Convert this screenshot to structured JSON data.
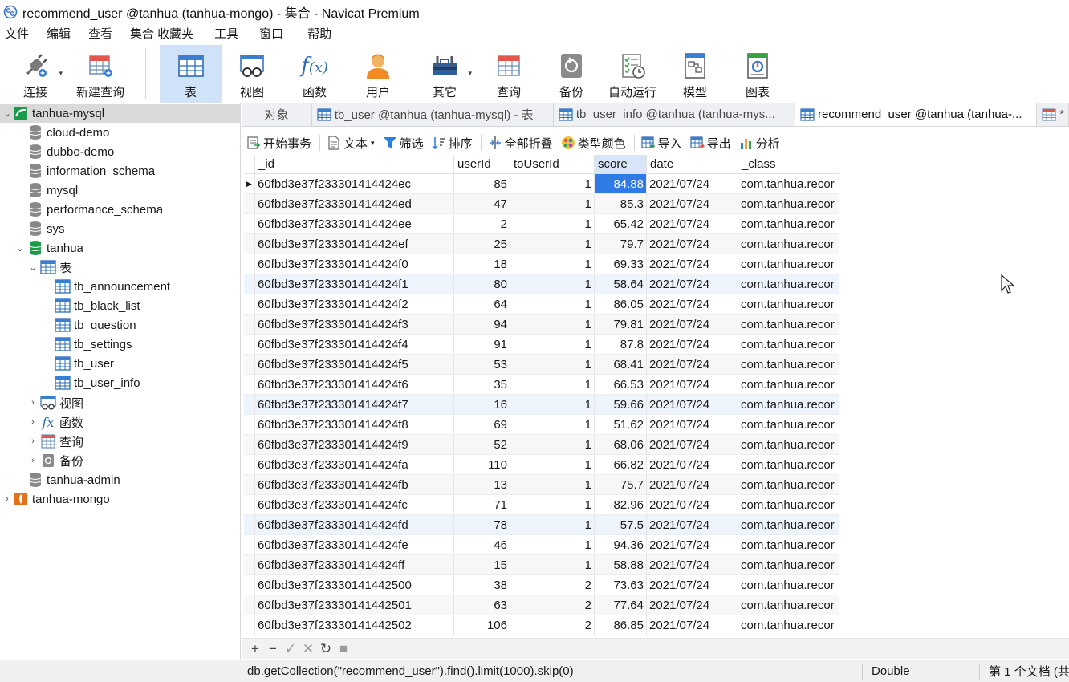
{
  "window": {
    "title": "recommend_user @tanhua (tanhua-mongo) - 集合 - Navicat Premium"
  },
  "menu": [
    "文件",
    "编辑",
    "查看",
    "集合",
    "收藏夹",
    "工具",
    "窗口",
    "帮助"
  ],
  "toolbar": {
    "items": [
      {
        "label": "连接",
        "icon": "plug-icon"
      },
      {
        "label": "新建查询",
        "icon": "new-query-icon"
      },
      {
        "label": "表",
        "icon": "table-icon",
        "active": true
      },
      {
        "label": "视图",
        "icon": "view-icon"
      },
      {
        "label": "函数",
        "icon": "function-icon"
      },
      {
        "label": "用户",
        "icon": "user-icon"
      },
      {
        "label": "其它",
        "icon": "tools-icon"
      },
      {
        "label": "查询",
        "icon": "query-icon"
      },
      {
        "label": "备份",
        "icon": "backup-icon"
      },
      {
        "label": "自动运行",
        "icon": "schedule-icon"
      },
      {
        "label": "模型",
        "icon": "model-icon"
      },
      {
        "label": "图表",
        "icon": "chart-icon"
      }
    ]
  },
  "tree": {
    "nodes": [
      {
        "label": "tanhua-mysql",
        "level": 0,
        "expanded": true,
        "icon": "mysql-connection-icon",
        "selected": true
      },
      {
        "label": "cloud-demo",
        "level": 1,
        "icon": "database-icon"
      },
      {
        "label": "dubbo-demo",
        "level": 1,
        "icon": "database-icon"
      },
      {
        "label": "information_schema",
        "level": 1,
        "icon": "database-icon"
      },
      {
        "label": "mysql",
        "level": 1,
        "icon": "database-icon"
      },
      {
        "label": "performance_schema",
        "level": 1,
        "icon": "database-icon"
      },
      {
        "label": "sys",
        "level": 1,
        "icon": "database-icon"
      },
      {
        "label": "tanhua",
        "level": 1,
        "expanded": true,
        "icon": "database-open-icon"
      },
      {
        "label": "表",
        "level": 2,
        "expanded": true,
        "icon": "tables-folder-icon"
      },
      {
        "label": "tb_announcement",
        "level": 3,
        "icon": "table-icon"
      },
      {
        "label": "tb_black_list",
        "level": 3,
        "icon": "table-icon"
      },
      {
        "label": "tb_question",
        "level": 3,
        "icon": "table-icon"
      },
      {
        "label": "tb_settings",
        "level": 3,
        "icon": "table-icon"
      },
      {
        "label": "tb_user",
        "level": 3,
        "icon": "table-icon"
      },
      {
        "label": "tb_user_info",
        "level": 3,
        "icon": "table-icon"
      },
      {
        "label": "视图",
        "level": 2,
        "expanded": false,
        "icon": "view-icon"
      },
      {
        "label": "函数",
        "level": 2,
        "expanded": false,
        "icon": "function-icon"
      },
      {
        "label": "查询",
        "level": 2,
        "expanded": false,
        "icon": "query-icon"
      },
      {
        "label": "备份",
        "level": 2,
        "expanded": false,
        "icon": "backup-icon"
      },
      {
        "label": "tanhua-admin",
        "level": 1,
        "icon": "database-icon"
      },
      {
        "label": "tanhua-mongo",
        "level": 0,
        "expanded": false,
        "icon": "mongo-connection-icon"
      }
    ]
  },
  "tabs": [
    {
      "label": "对象",
      "icon": ""
    },
    {
      "label": "tb_user @tanhua (tanhua-mysql) - 表",
      "icon": "table-icon"
    },
    {
      "label": "tb_user_info @tanhua (tanhua-mys...",
      "icon": "table-icon"
    },
    {
      "label": "recommend_user @tanhua (tanhua-...",
      "icon": "table-icon",
      "active": true
    },
    {
      "label": "*",
      "icon": "table-icon"
    }
  ],
  "object_toolbar": {
    "begin_tx": "开始事务",
    "text": "文本",
    "filter": "筛选",
    "sort": "排序",
    "collapse_all": "全部折叠",
    "type_color": "类型颜色",
    "import": "导入",
    "export": "导出",
    "analyze": "分析"
  },
  "grid": {
    "columns": [
      "_id",
      "userId",
      "toUserId",
      "score",
      "date",
      "_class"
    ],
    "selected_column": "score",
    "rows": [
      [
        "60fbd3e37f233301414424ec",
        "85",
        "1",
        "84.88",
        "2021/07/24",
        "com.tanhua.recor"
      ],
      [
        "60fbd3e37f233301414424ed",
        "47",
        "1",
        "85.3",
        "2021/07/24",
        "com.tanhua.recor"
      ],
      [
        "60fbd3e37f233301414424ee",
        "2",
        "1",
        "65.42",
        "2021/07/24",
        "com.tanhua.recor"
      ],
      [
        "60fbd3e37f233301414424ef",
        "25",
        "1",
        "79.7",
        "2021/07/24",
        "com.tanhua.recor"
      ],
      [
        "60fbd3e37f233301414424f0",
        "18",
        "1",
        "69.33",
        "2021/07/24",
        "com.tanhua.recor"
      ],
      [
        "60fbd3e37f233301414424f1",
        "80",
        "1",
        "58.64",
        "2021/07/24",
        "com.tanhua.recor"
      ],
      [
        "60fbd3e37f233301414424f2",
        "64",
        "1",
        "86.05",
        "2021/07/24",
        "com.tanhua.recor"
      ],
      [
        "60fbd3e37f233301414424f3",
        "94",
        "1",
        "79.81",
        "2021/07/24",
        "com.tanhua.recor"
      ],
      [
        "60fbd3e37f233301414424f4",
        "91",
        "1",
        "87.8",
        "2021/07/24",
        "com.tanhua.recor"
      ],
      [
        "60fbd3e37f233301414424f5",
        "53",
        "1",
        "68.41",
        "2021/07/24",
        "com.tanhua.recor"
      ],
      [
        "60fbd3e37f233301414424f6",
        "35",
        "1",
        "66.53",
        "2021/07/24",
        "com.tanhua.recor"
      ],
      [
        "60fbd3e37f233301414424f7",
        "16",
        "1",
        "59.66",
        "2021/07/24",
        "com.tanhua.recor"
      ],
      [
        "60fbd3e37f233301414424f8",
        "69",
        "1",
        "51.62",
        "2021/07/24",
        "com.tanhua.recor"
      ],
      [
        "60fbd3e37f233301414424f9",
        "52",
        "1",
        "68.06",
        "2021/07/24",
        "com.tanhua.recor"
      ],
      [
        "60fbd3e37f233301414424fa",
        "110",
        "1",
        "66.82",
        "2021/07/24",
        "com.tanhua.recor"
      ],
      [
        "60fbd3e37f233301414424fb",
        "13",
        "1",
        "75.7",
        "2021/07/24",
        "com.tanhua.recor"
      ],
      [
        "60fbd3e37f233301414424fc",
        "71",
        "1",
        "82.96",
        "2021/07/24",
        "com.tanhua.recor"
      ],
      [
        "60fbd3e37f233301414424fd",
        "78",
        "1",
        "57.5",
        "2021/07/24",
        "com.tanhua.recor"
      ],
      [
        "60fbd3e37f233301414424fe",
        "46",
        "1",
        "94.36",
        "2021/07/24",
        "com.tanhua.recor"
      ],
      [
        "60fbd3e37f233301414424ff",
        "15",
        "1",
        "58.88",
        "2021/07/24",
        "com.tanhua.recor"
      ],
      [
        "60fbd3e37f23330141442500",
        "38",
        "2",
        "73.63",
        "2021/07/24",
        "com.tanhua.recor"
      ],
      [
        "60fbd3e37f23330141442501",
        "63",
        "2",
        "77.64",
        "2021/07/24",
        "com.tanhua.recor"
      ],
      [
        "60fbd3e37f23330141442502",
        "106",
        "2",
        "86.85",
        "2021/07/24",
        "com.tanhua.recor"
      ]
    ]
  },
  "grid_footer": {
    "icons": [
      "add-icon",
      "remove-icon",
      "apply-icon",
      "discard-icon",
      "refresh-icon",
      "stop-icon"
    ]
  },
  "status": {
    "query": "db.getCollection(\"recommend_user\").find().limit(1000).skip(0)",
    "data_type": "Double",
    "doc_info": "第 1 个文档 (共"
  },
  "colors": {
    "selection": "#2f7ae5",
    "active_tool": "#cfe2f7",
    "mysql_green": "#1a9b4b",
    "mongo_orange": "#e3731b"
  }
}
